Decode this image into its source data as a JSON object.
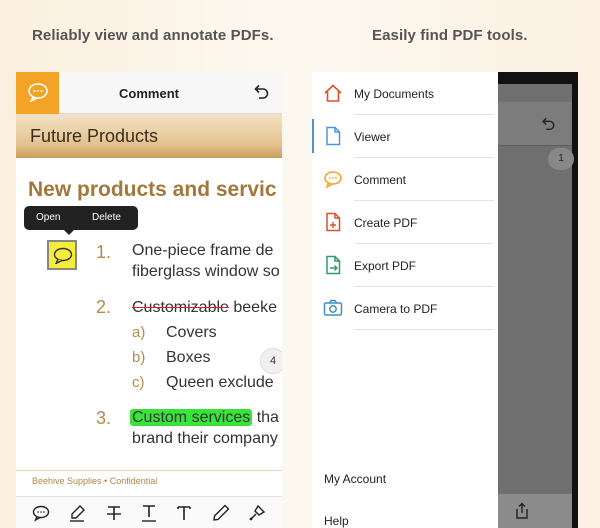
{
  "captions": {
    "left": "Reliably view and annotate PDFs.",
    "right": "Easily find PDF tools."
  },
  "left_screen": {
    "topbar": {
      "title": "Comment",
      "active_tool_icon": "comment-bubble-icon",
      "undo_icon": "undo-icon"
    },
    "document": {
      "header": "Future Products",
      "heading": "New products and servic",
      "popover": {
        "open_label": "Open",
        "delete_label": "Delete"
      },
      "items": [
        {
          "number": "1.",
          "lines": [
            "One-piece frame de",
            "fiberglass window so"
          ]
        },
        {
          "number": "2.",
          "struck": "Customizable",
          "rest": " beeke"
        },
        {
          "number": "3.",
          "highlight": "Custom services",
          "rest": " tha",
          "line2": "brand their company"
        }
      ],
      "subitems": [
        {
          "letter": "a)",
          "text": "Covers"
        },
        {
          "letter": "b)",
          "text": "Boxes"
        },
        {
          "letter": "c)",
          "text": "Queen exclude"
        }
      ],
      "page_badge": "4",
      "footer": "Beehive Supplies  •  Confidential"
    },
    "toolbar": [
      "comment-icon",
      "draw-icon",
      "strikethrough-icon",
      "underline-icon",
      "text-icon",
      "pencil-icon",
      "stamp-icon"
    ]
  },
  "right_screen": {
    "menu": [
      {
        "label": "My Documents",
        "icon": "home-icon"
      },
      {
        "label": "Viewer",
        "icon": "document-icon"
      },
      {
        "label": "Comment",
        "icon": "comment-icon"
      },
      {
        "label": "Create PDF",
        "icon": "create-pdf-icon"
      },
      {
        "label": "Export PDF",
        "icon": "export-pdf-icon"
      },
      {
        "label": "Camera to PDF",
        "icon": "camera-icon"
      }
    ],
    "footer": {
      "account": "My Account",
      "help": "Help"
    },
    "background_page_badge": "1"
  },
  "colors": {
    "accent_orange": "#f3a325",
    "heading_gold": "#a4773a",
    "highlight_green": "#39e43a",
    "strike_red": "#dd2222",
    "viewer_active_blue": "#4e95d8"
  }
}
